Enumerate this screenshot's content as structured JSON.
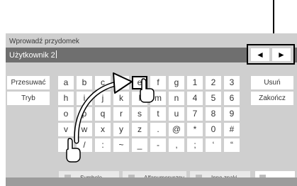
{
  "dialog": {
    "title": "Wprowadź przydomek"
  },
  "input": {
    "value": "Użytkownik 2"
  },
  "cursor_nav": {
    "left_symbol": "◄",
    "right_symbol": "►"
  },
  "left_keys": [
    "Przesuwać",
    "Tryb"
  ],
  "right_keys": [
    "Usuń",
    "Zakończ"
  ],
  "keyboard_rows": [
    [
      "a",
      "b",
      "c",
      "d",
      "e",
      "f",
      "g",
      "1",
      "2",
      "3"
    ],
    [
      "h",
      "i",
      "j",
      "k",
      "l",
      "m",
      "n",
      "4",
      "5",
      "6"
    ],
    [
      "o",
      "p",
      "q",
      "r",
      "s",
      "t",
      "u",
      "7",
      "8",
      "9"
    ],
    [
      "v",
      "w",
      "x",
      "y",
      "z",
      ".",
      "@",
      "*",
      "0",
      "#"
    ],
    [
      "",
      "/",
      ":",
      "~",
      "_",
      "-",
      ",",
      ";",
      "‘",
      "“"
    ]
  ],
  "highlighted_key": "e",
  "mode_buttons": [
    "Symbole",
    "Alfanumeryczny",
    "Inne znaki"
  ],
  "colors": {
    "panel": "#cfcfcf",
    "input_bar": "#6f6f6f",
    "key": "#ffffff",
    "footer": "#9c9c9c"
  }
}
